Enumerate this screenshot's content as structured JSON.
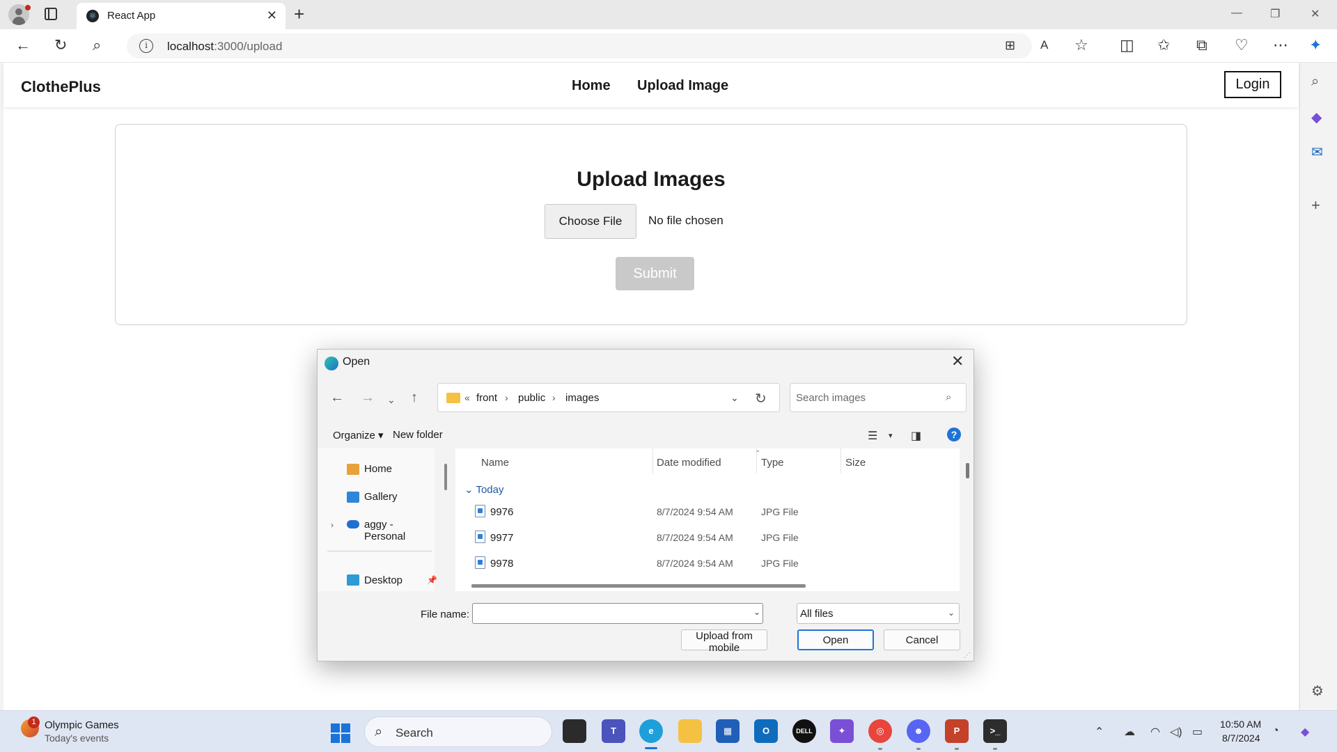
{
  "browser": {
    "tab_title": "React App",
    "url_host": "localhost",
    "url_path": ":3000/upload"
  },
  "site": {
    "brand": "ClothePlus",
    "nav": [
      "Home",
      "Upload Image"
    ],
    "login_label": "Login"
  },
  "upload": {
    "title": "Upload Images",
    "choose_label": "Choose File",
    "file_status": "No file chosen",
    "submit_label": "Submit"
  },
  "dialog": {
    "title": "Open",
    "breadcrumb": {
      "overflow": "«",
      "parts": [
        "front",
        "public",
        "images"
      ]
    },
    "search_placeholder": "Search images",
    "organize_label": "Organize",
    "new_folder_label": "New folder",
    "nav_items": [
      {
        "label": "Home",
        "icon": "home-icon"
      },
      {
        "label": "Gallery",
        "icon": "gallery-icon"
      },
      {
        "label": "aggy - Personal",
        "icon": "onedrive-icon"
      },
      {
        "label": "Desktop",
        "icon": "desktop-icon"
      }
    ],
    "columns": [
      "Name",
      "Date modified",
      "Type",
      "Size"
    ],
    "group_label": "Today",
    "files": [
      {
        "name": "9976",
        "date": "8/7/2024 9:54 AM",
        "type": "JPG File"
      },
      {
        "name": "9977",
        "date": "8/7/2024 9:54 AM",
        "type": "JPG File"
      },
      {
        "name": "9978",
        "date": "8/7/2024 9:54 AM",
        "type": "JPG File"
      }
    ],
    "file_name_label": "File name:",
    "file_name_value": "",
    "file_type_value": "All files",
    "buttons": {
      "upload_mobile": "Upload from mobile",
      "open": "Open",
      "cancel": "Cancel"
    }
  },
  "taskbar": {
    "widget_badge": "1",
    "widget_title": "Olympic Games",
    "widget_subtitle": "Today's events",
    "search_label": "Search",
    "time": "10:50 AM",
    "date": "8/7/2024"
  },
  "colors": {
    "accent": "#1e73d6",
    "submit_disabled": "#c9c9c9",
    "breadcrumb_folder": "#f4c143"
  }
}
